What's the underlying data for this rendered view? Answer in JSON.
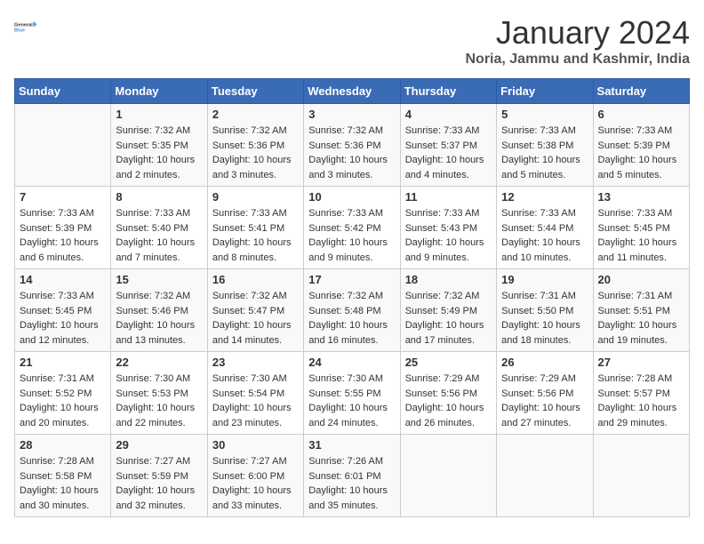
{
  "header": {
    "logo": {
      "line1": "General",
      "line2": "Blue"
    },
    "title": "January 2024",
    "subtitle": "Noria, Jammu and Kashmir, India"
  },
  "weekdays": [
    "Sunday",
    "Monday",
    "Tuesday",
    "Wednesday",
    "Thursday",
    "Friday",
    "Saturday"
  ],
  "weeks": [
    [
      {
        "day": "",
        "info": ""
      },
      {
        "day": "1",
        "info": "Sunrise: 7:32 AM\nSunset: 5:35 PM\nDaylight: 10 hours\nand 2 minutes."
      },
      {
        "day": "2",
        "info": "Sunrise: 7:32 AM\nSunset: 5:36 PM\nDaylight: 10 hours\nand 3 minutes."
      },
      {
        "day": "3",
        "info": "Sunrise: 7:32 AM\nSunset: 5:36 PM\nDaylight: 10 hours\nand 3 minutes."
      },
      {
        "day": "4",
        "info": "Sunrise: 7:33 AM\nSunset: 5:37 PM\nDaylight: 10 hours\nand 4 minutes."
      },
      {
        "day": "5",
        "info": "Sunrise: 7:33 AM\nSunset: 5:38 PM\nDaylight: 10 hours\nand 5 minutes."
      },
      {
        "day": "6",
        "info": "Sunrise: 7:33 AM\nSunset: 5:39 PM\nDaylight: 10 hours\nand 5 minutes."
      }
    ],
    [
      {
        "day": "7",
        "info": "Sunrise: 7:33 AM\nSunset: 5:39 PM\nDaylight: 10 hours\nand 6 minutes."
      },
      {
        "day": "8",
        "info": "Sunrise: 7:33 AM\nSunset: 5:40 PM\nDaylight: 10 hours\nand 7 minutes."
      },
      {
        "day": "9",
        "info": "Sunrise: 7:33 AM\nSunset: 5:41 PM\nDaylight: 10 hours\nand 8 minutes."
      },
      {
        "day": "10",
        "info": "Sunrise: 7:33 AM\nSunset: 5:42 PM\nDaylight: 10 hours\nand 9 minutes."
      },
      {
        "day": "11",
        "info": "Sunrise: 7:33 AM\nSunset: 5:43 PM\nDaylight: 10 hours\nand 9 minutes."
      },
      {
        "day": "12",
        "info": "Sunrise: 7:33 AM\nSunset: 5:44 PM\nDaylight: 10 hours\nand 10 minutes."
      },
      {
        "day": "13",
        "info": "Sunrise: 7:33 AM\nSunset: 5:45 PM\nDaylight: 10 hours\nand 11 minutes."
      }
    ],
    [
      {
        "day": "14",
        "info": "Sunrise: 7:33 AM\nSunset: 5:45 PM\nDaylight: 10 hours\nand 12 minutes."
      },
      {
        "day": "15",
        "info": "Sunrise: 7:32 AM\nSunset: 5:46 PM\nDaylight: 10 hours\nand 13 minutes."
      },
      {
        "day": "16",
        "info": "Sunrise: 7:32 AM\nSunset: 5:47 PM\nDaylight: 10 hours\nand 14 minutes."
      },
      {
        "day": "17",
        "info": "Sunrise: 7:32 AM\nSunset: 5:48 PM\nDaylight: 10 hours\nand 16 minutes."
      },
      {
        "day": "18",
        "info": "Sunrise: 7:32 AM\nSunset: 5:49 PM\nDaylight: 10 hours\nand 17 minutes."
      },
      {
        "day": "19",
        "info": "Sunrise: 7:31 AM\nSunset: 5:50 PM\nDaylight: 10 hours\nand 18 minutes."
      },
      {
        "day": "20",
        "info": "Sunrise: 7:31 AM\nSunset: 5:51 PM\nDaylight: 10 hours\nand 19 minutes."
      }
    ],
    [
      {
        "day": "21",
        "info": "Sunrise: 7:31 AM\nSunset: 5:52 PM\nDaylight: 10 hours\nand 20 minutes."
      },
      {
        "day": "22",
        "info": "Sunrise: 7:30 AM\nSunset: 5:53 PM\nDaylight: 10 hours\nand 22 minutes."
      },
      {
        "day": "23",
        "info": "Sunrise: 7:30 AM\nSunset: 5:54 PM\nDaylight: 10 hours\nand 23 minutes."
      },
      {
        "day": "24",
        "info": "Sunrise: 7:30 AM\nSunset: 5:55 PM\nDaylight: 10 hours\nand 24 minutes."
      },
      {
        "day": "25",
        "info": "Sunrise: 7:29 AM\nSunset: 5:56 PM\nDaylight: 10 hours\nand 26 minutes."
      },
      {
        "day": "26",
        "info": "Sunrise: 7:29 AM\nSunset: 5:56 PM\nDaylight: 10 hours\nand 27 minutes."
      },
      {
        "day": "27",
        "info": "Sunrise: 7:28 AM\nSunset: 5:57 PM\nDaylight: 10 hours\nand 29 minutes."
      }
    ],
    [
      {
        "day": "28",
        "info": "Sunrise: 7:28 AM\nSunset: 5:58 PM\nDaylight: 10 hours\nand 30 minutes."
      },
      {
        "day": "29",
        "info": "Sunrise: 7:27 AM\nSunset: 5:59 PM\nDaylight: 10 hours\nand 32 minutes."
      },
      {
        "day": "30",
        "info": "Sunrise: 7:27 AM\nSunset: 6:00 PM\nDaylight: 10 hours\nand 33 minutes."
      },
      {
        "day": "31",
        "info": "Sunrise: 7:26 AM\nSunset: 6:01 PM\nDaylight: 10 hours\nand 35 minutes."
      },
      {
        "day": "",
        "info": ""
      },
      {
        "day": "",
        "info": ""
      },
      {
        "day": "",
        "info": ""
      }
    ]
  ]
}
